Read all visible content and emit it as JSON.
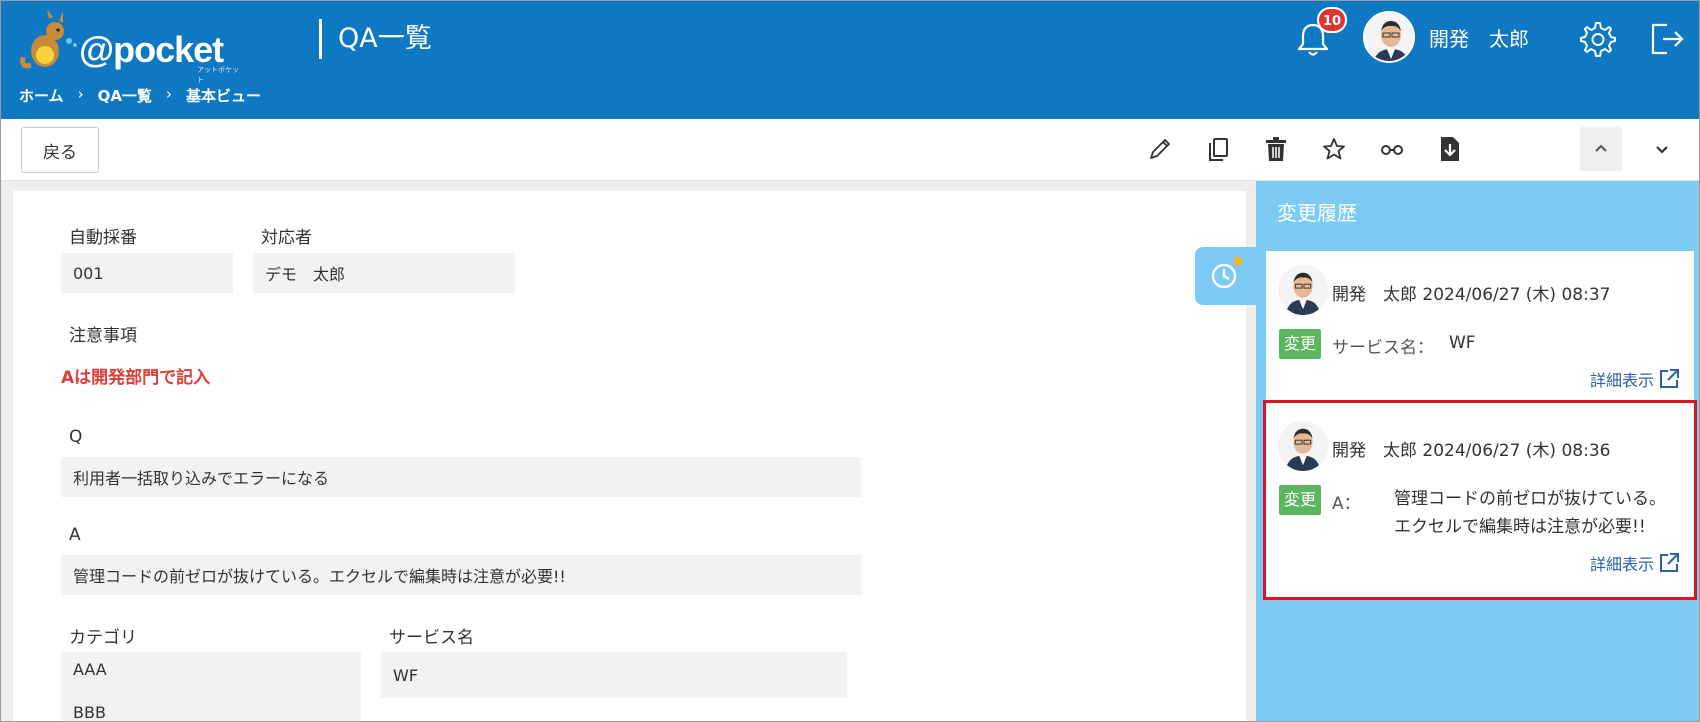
{
  "header": {
    "logo_text": "@pocket",
    "logo_sub": "アットポケット",
    "page_title": "QA一覧",
    "breadcrumb": [
      "ホーム",
      "QA一覧",
      "基本ビュー"
    ],
    "notification_count": "10",
    "user_name": "開発　太郎",
    "colors": {
      "header_bg": "#0f78c3",
      "badge": "#e0342f"
    }
  },
  "toolbar": {
    "back_label": "戻る",
    "icons": [
      "pencil-icon",
      "copy-icon",
      "trash-icon",
      "star-icon",
      "glasses-icon",
      "download-file-icon",
      "chevron-up-icon",
      "chevron-down-icon"
    ]
  },
  "form": {
    "auto_number": {
      "label": "自動採番",
      "value": "001"
    },
    "assignee": {
      "label": "対応者",
      "value": "デモ　太郎"
    },
    "notes": {
      "label": "注意事項",
      "value": "Aは開発部門で記入"
    },
    "q": {
      "label": "Q",
      "value": "利用者一括取り込みでエラーになる"
    },
    "a": {
      "label": "A",
      "value": "管理コードの前ゼロが抜けている。エクセルで編集時は注意が必要!!"
    },
    "category": {
      "label": "カテゴリ",
      "values": [
        "AAA",
        "BBB"
      ]
    },
    "service": {
      "label": "サービス名",
      "value": "WF"
    }
  },
  "history": {
    "title": "変更履歴",
    "entries": [
      {
        "user": "開発　太郎",
        "datetime": "2024/06/27 (木) 08:37",
        "badge": "変更",
        "field": "サービス名：",
        "value_lines": [
          "WF"
        ],
        "link": "詳細表示"
      },
      {
        "user": "開発　太郎",
        "datetime": "2024/06/27 (木) 08:36",
        "badge": "変更",
        "field": "A：",
        "value_lines": [
          "管理コードの前ゼロが抜けている。",
          "エクセルで編集時は注意が必要!!"
        ],
        "link": "詳細表示"
      }
    ],
    "colors": {
      "panel_bg": "#7ccbf5",
      "badge": "#5cb660",
      "highlight": "#e0141c"
    }
  }
}
